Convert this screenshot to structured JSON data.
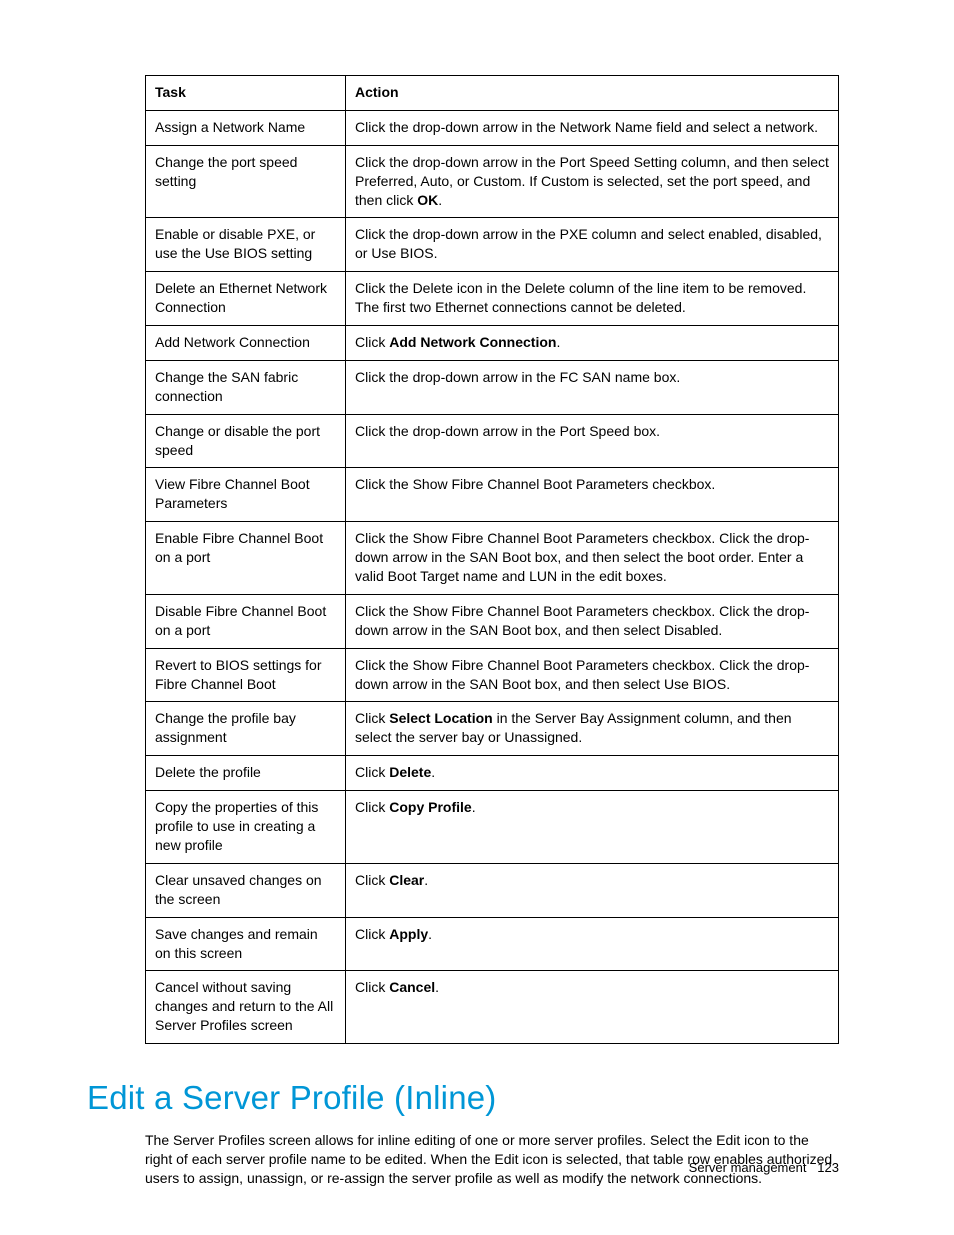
{
  "table": {
    "headers": {
      "task": "Task",
      "action": "Action"
    },
    "rows": [
      {
        "task": "Assign a Network Name",
        "action": "Click the drop-down arrow in the Network Name field and select a network."
      },
      {
        "task": "Change the port speed setting",
        "action": "Click the drop-down arrow in the Port Speed Setting column, and then select Preferred, Auto, or Custom. If Custom is selected, set the port speed, and then click <b>OK</b>."
      },
      {
        "task": "Enable or disable PXE, or use the Use BIOS setting",
        "action": "Click the drop-down arrow in the PXE column and select enabled, disabled, or Use BIOS."
      },
      {
        "task": "Delete an Ethernet Network Connection",
        "action": "Click the Delete icon in the Delete column of the line item to be removed. The first two Ethernet connections cannot be deleted."
      },
      {
        "task": "Add Network Connection",
        "action": "Click <b>Add Network Connection</b>."
      },
      {
        "task": "Change the SAN fabric connection",
        "action": "Click the drop-down arrow in the FC SAN name box."
      },
      {
        "task": "Change or disable the port speed",
        "action": "Click the drop-down arrow in the Port Speed box."
      },
      {
        "task": "View Fibre Channel Boot Parameters",
        "action": "Click the Show Fibre Channel Boot Parameters checkbox."
      },
      {
        "task": "Enable Fibre Channel Boot on a port",
        "action": "Click the Show Fibre Channel Boot Parameters checkbox. Click the drop-down arrow in the SAN Boot box, and then select the boot order. Enter a valid Boot Target name and LUN in the edit boxes."
      },
      {
        "task": "Disable Fibre Channel Boot on a port",
        "action": "Click the Show Fibre Channel Boot Parameters checkbox. Click the drop-down arrow in the SAN Boot box, and then select Disabled."
      },
      {
        "task": "Revert to BIOS settings for Fibre Channel Boot",
        "action": "Click the Show Fibre Channel Boot Parameters checkbox. Click the drop-down arrow in the SAN Boot box, and then select Use BIOS."
      },
      {
        "task": "Change the profile bay assignment",
        "action": "Click <b>Select Location</b> in the Server Bay Assignment column, and then select the server bay or Unassigned."
      },
      {
        "task": "Delete the profile",
        "action": "Click <b>Delete</b>."
      },
      {
        "task": "Copy the properties of this profile to use in creating a new profile",
        "action": "Click <b>Copy Profile</b>."
      },
      {
        "task": "Clear unsaved changes on the screen",
        "action": "Click <b>Clear</b>."
      },
      {
        "task": "Save changes and remain on this screen",
        "action": "Click <b>Apply</b>."
      },
      {
        "task": "Cancel without saving changes and return to the All Server Profiles screen",
        "action": "Click <b>Cancel</b>."
      }
    ]
  },
  "section": {
    "heading": "Edit a Server Profile (Inline)",
    "body": "The Server Profiles screen allows for inline editing of one or more server profiles. Select the Edit icon to the right of each server profile name to be edited. When the Edit icon is selected, that table row enables authorized users to assign, unassign, or re-assign the server profile as well as modify the network connections."
  },
  "footer": {
    "section": "Server management",
    "page": "123"
  }
}
